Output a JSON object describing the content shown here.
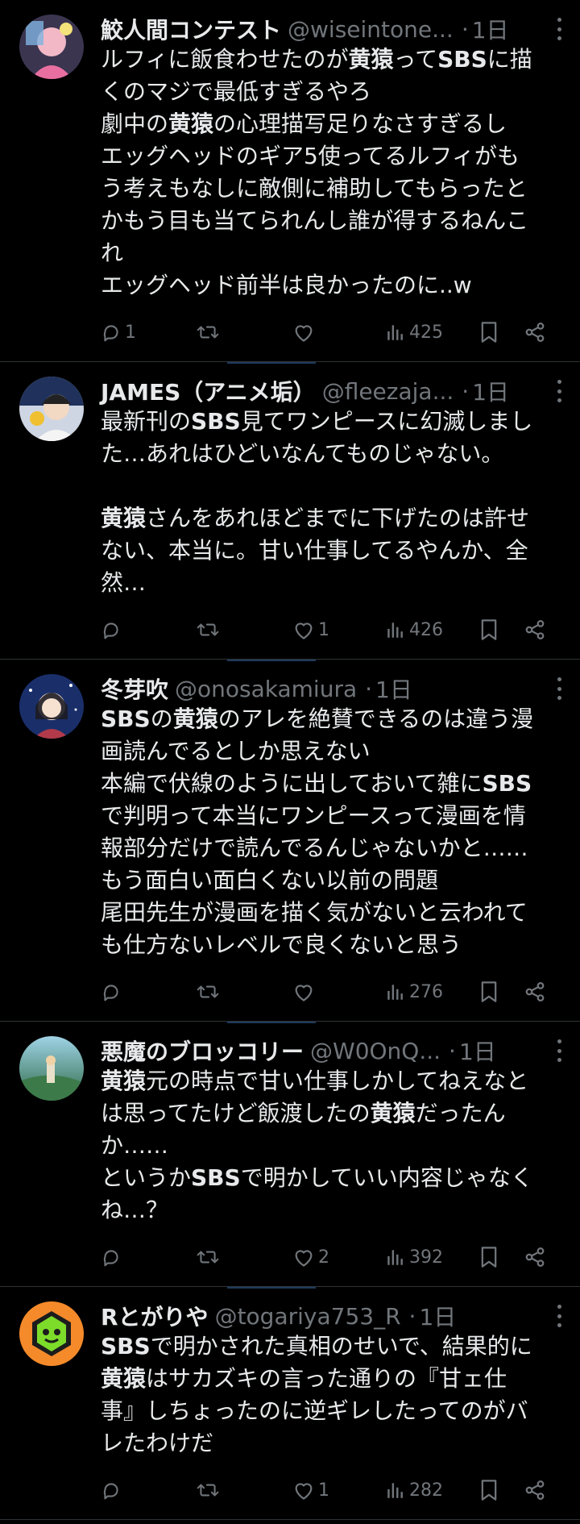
{
  "tweets": [
    {
      "name": "鮫人間コンテスト",
      "handle": "@wiseintone...",
      "time": "1日",
      "lines": [
        [
          {
            "t": "ルフィに飯食わせたのが"
          },
          {
            "t": "黄猿",
            "b": true
          },
          {
            "t": "って"
          },
          {
            "t": "SBS",
            "b": true
          },
          {
            "t": "に描"
          }
        ],
        [
          {
            "t": "くのマジで最低すぎるやろ"
          }
        ],
        [
          {
            "t": "劇中の"
          },
          {
            "t": "黄猿",
            "b": true
          },
          {
            "t": "の心理描写足りなさすぎるし"
          }
        ],
        [
          {
            "t": "エッグヘッドのギア5使ってるルフィがも"
          }
        ],
        [
          {
            "t": "う考えもなしに敵側に補助してもらったと"
          }
        ],
        [
          {
            "t": "かもう目も当てられんし誰が得するねんこ"
          }
        ],
        [
          {
            "t": "れ"
          }
        ],
        [
          {
            "t": "エッグヘッド前半は良かったのに..w"
          }
        ]
      ],
      "replies": "1",
      "retweets": "",
      "likes": "",
      "views": "425"
    },
    {
      "name": "JAMES（アニメ垢）",
      "handle": "@fleezaja...",
      "time": "1日",
      "lines": [
        [
          {
            "t": "最新刊の"
          },
          {
            "t": "SBS",
            "b": true
          },
          {
            "t": "見てワンピースに幻滅しまし"
          }
        ],
        [
          {
            "t": "た…あれはひどいなんてものじゃない。"
          }
        ],
        [],
        [
          {
            "t": "黄猿",
            "b": true
          },
          {
            "t": "さんをあれほどまでに下げたのは許せ"
          }
        ],
        [
          {
            "t": "ない、本当に。甘い仕事してるやんか、全"
          }
        ],
        [
          {
            "t": "然…"
          }
        ]
      ],
      "replies": "",
      "retweets": "",
      "likes": "1",
      "views": "426"
    },
    {
      "name": "冬芽吹",
      "handle": "@onosakamiura",
      "time": "1日",
      "lines": [
        [
          {
            "t": "SBS",
            "b": true
          },
          {
            "t": "の"
          },
          {
            "t": "黄猿",
            "b": true
          },
          {
            "t": "のアレを絶賛できるのは違う漫"
          }
        ],
        [
          {
            "t": "画読んでるとしか思えない"
          }
        ],
        [
          {
            "t": "本編で伏線のように出しておいて雑に"
          },
          {
            "t": "SBS",
            "b": true
          }
        ],
        [
          {
            "t": "で判明って本当にワンピースって漫画を情"
          }
        ],
        [
          {
            "t": "報部分だけで読んでるんじゃないかと……"
          }
        ],
        [
          {
            "t": "もう面白い面白くない以前の問題"
          }
        ],
        [
          {
            "t": "尾田先生が漫画を描く気がないと云われて"
          }
        ],
        [
          {
            "t": "も仕方ないレベルで良くないと思う"
          }
        ]
      ],
      "replies": "",
      "retweets": "",
      "likes": "",
      "views": "276"
    },
    {
      "name": "悪魔のブロッコリー",
      "handle": "@W0OnQ...",
      "time": "1日",
      "lines": [
        [
          {
            "t": "黄猿",
            "b": true
          },
          {
            "t": "元の時点で甘い仕事しかしてねえなと"
          }
        ],
        [
          {
            "t": "は思ってたけど飯渡したの"
          },
          {
            "t": "黄猿",
            "b": true
          },
          {
            "t": "だったん"
          }
        ],
        [
          {
            "t": "か……"
          }
        ],
        [
          {
            "t": "というか"
          },
          {
            "t": "SBS",
            "b": true
          },
          {
            "t": "で明かしていい内容じゃなく"
          }
        ],
        [
          {
            "t": "ね…？"
          }
        ]
      ],
      "replies": "",
      "retweets": "",
      "likes": "2",
      "views": "392"
    },
    {
      "name": "Rとがりや",
      "handle": "@togariya753_R",
      "time": "1日",
      "lines": [
        [
          {
            "t": "SBS",
            "b": true
          },
          {
            "t": "で明かされた真相のせいで、結果的に"
          }
        ],
        [
          {
            "t": "黄猿",
            "b": true
          },
          {
            "t": "はサカズキの言った通りの『甘ェ仕"
          }
        ],
        [
          {
            "t": "事』しちょったのに逆ギレしたってのがバ"
          }
        ],
        [
          {
            "t": "レたわけだ"
          }
        ]
      ],
      "replies": "",
      "retweets": "",
      "likes": "1",
      "views": "282"
    }
  ],
  "icons": {
    "reply": "reply-icon",
    "retweet": "retweet-icon",
    "like": "heart-icon",
    "views": "analytics-icon",
    "bookmark": "bookmark-icon",
    "share": "share-icon",
    "more": "more-icon"
  },
  "colors": {
    "background": "#000000",
    "text": "#e7e9ea",
    "muted": "#71767b",
    "divider": "#2f3336"
  }
}
